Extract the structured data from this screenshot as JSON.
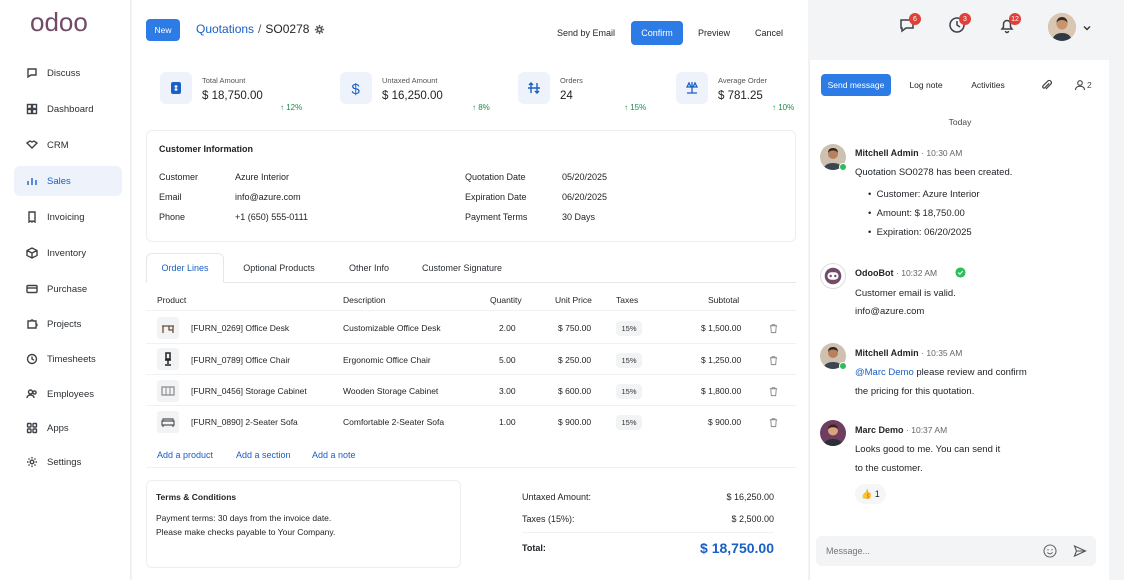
{
  "brand": {
    "logo_text": "odoo"
  },
  "sidebar": {
    "items": [
      {
        "label": "Discuss",
        "icon": "chat-bubble-icon"
      },
      {
        "label": "Dashboard",
        "icon": "dashboard-grid-icon"
      },
      {
        "label": "CRM",
        "icon": "handshake-icon"
      },
      {
        "label": "Sales",
        "icon": "bar-chart-icon",
        "active": true
      },
      {
        "label": "Invoicing",
        "icon": "invoice-icon"
      },
      {
        "label": "Inventory",
        "icon": "box-icon"
      },
      {
        "label": "Purchase",
        "icon": "credit-card-icon"
      },
      {
        "label": "Projects",
        "icon": "puzzle-icon"
      },
      {
        "label": "Timesheets",
        "icon": "clock-icon"
      },
      {
        "label": "Employees",
        "icon": "people-icon"
      },
      {
        "label": "Apps",
        "icon": "apps-grid-icon"
      },
      {
        "label": "Settings",
        "icon": "gear-icon"
      }
    ]
  },
  "header": {
    "new_label": "New",
    "breadcrumb_parent": "Quotations",
    "breadcrumb_sep": "/",
    "breadcrumb_current": "SO0278",
    "send_email_label": "Send by Email",
    "confirm_label": "Confirm",
    "preview_label": "Preview",
    "cancel_label": "Cancel"
  },
  "topbar": {
    "messages_count": "6",
    "activities_count": "3",
    "notifications_count": "12"
  },
  "kpis": [
    {
      "label": "Total Amount",
      "value": "$ 18,750.00",
      "trend": "12%",
      "icon": "receipt-icon"
    },
    {
      "label": "Untaxed Amount",
      "value": "$ 16,250.00",
      "trend": "8%",
      "icon": "dollar-icon"
    },
    {
      "label": "Orders",
      "value": "24",
      "trend": "15%",
      "icon": "sort-arrows-icon"
    },
    {
      "label": "Average Order",
      "value": "$ 781.25",
      "trend": "10%",
      "icon": "scale-icon"
    }
  ],
  "customer": {
    "title": "Customer Information",
    "customer_label": "Customer",
    "customer_value": "Azure Interior",
    "email_label": "Email",
    "email_value": "info@azure.com",
    "phone_label": "Phone",
    "phone_value": "+1 (650) 555-0111",
    "qdate_label": "Quotation Date",
    "qdate_value": "05/20/2025",
    "edate_label": "Expiration Date",
    "edate_value": "06/20/2025",
    "terms_label": "Payment Terms",
    "terms_value": "30 Days"
  },
  "tabs": [
    "Order Lines",
    "Optional Products",
    "Other Info",
    "Customer Signature"
  ],
  "table": {
    "headers": [
      "Product",
      "Description",
      "Quantity",
      "Unit Price",
      "Taxes",
      "Subtotal"
    ],
    "rows": [
      {
        "product": "[FURN_0269] Office Desk",
        "description": "Customizable Office Desk",
        "qty": "2.00",
        "price": "$ 750.00",
        "tax": "15%",
        "subtotal": "$ 1,500.00"
      },
      {
        "product": "[FURN_0789] Office Chair",
        "description": "Ergonomic Office Chair",
        "qty": "5.00",
        "price": "$ 250.00",
        "tax": "15%",
        "subtotal": "$ 1,250.00"
      },
      {
        "product": "[FURN_0456] Storage Cabinet",
        "description": "Wooden Storage Cabinet",
        "qty": "3.00",
        "price": "$ 600.00",
        "tax": "15%",
        "subtotal": "$ 1,800.00"
      },
      {
        "product": "[FURN_0890] 2-Seater Sofa",
        "description": "Comfortable 2-Seater Sofa",
        "qty": "1.00",
        "price": "$ 900.00",
        "tax": "15%",
        "subtotal": "$ 900.00"
      }
    ],
    "add_product": "Add a product",
    "add_section": "Add a section",
    "add_note": "Add a note"
  },
  "terms": {
    "title": "Terms & Conditions",
    "line1": "Payment terms: 30 days from the invoice date.",
    "line2": "Please make checks payable to Your Company."
  },
  "totals": {
    "untaxed_label": "Untaxed Amount:",
    "untaxed_value": "$ 16,250.00",
    "taxes_label": "Taxes (15%):",
    "taxes_value": "$ 2,500.00",
    "total_label": "Total:",
    "total_value": "$ 18,750.00"
  },
  "chatter": {
    "send_message": "Send message",
    "log_note": "Log note",
    "activities": "Activities",
    "followers": "2",
    "today": "Today",
    "messages": [
      {
        "author": "Mitchell Admin",
        "time": "10:30 AM",
        "text": "Quotation SO0278 has been created.",
        "bullets": [
          "Customer: Azure Interior",
          "Amount: $ 18,750.00",
          "Expiration: 06/20/2025"
        ]
      },
      {
        "author": "OdooBot",
        "time": "10:32 AM",
        "line1": "Customer email is valid.",
        "line2": "info@azure.com"
      },
      {
        "author": "Mitchell Admin",
        "time": "10:35 AM",
        "mention": "@Marc Demo",
        "line1_rest": " please review and confirm",
        "line2": "the pricing for this quotation."
      },
      {
        "author": "Marc Demo",
        "time": "10:37 AM",
        "line1": "Looks good to me. You can send it",
        "line2": "to the customer.",
        "reaction": "👍",
        "reaction_count": "1"
      }
    ],
    "composer_placeholder": "Message..."
  },
  "colors": {
    "accent": "#2d7be5",
    "link": "#1a5fc4",
    "trend_up": "#1f8b4c",
    "badge": "#e0403a",
    "brand": "#714b67"
  }
}
